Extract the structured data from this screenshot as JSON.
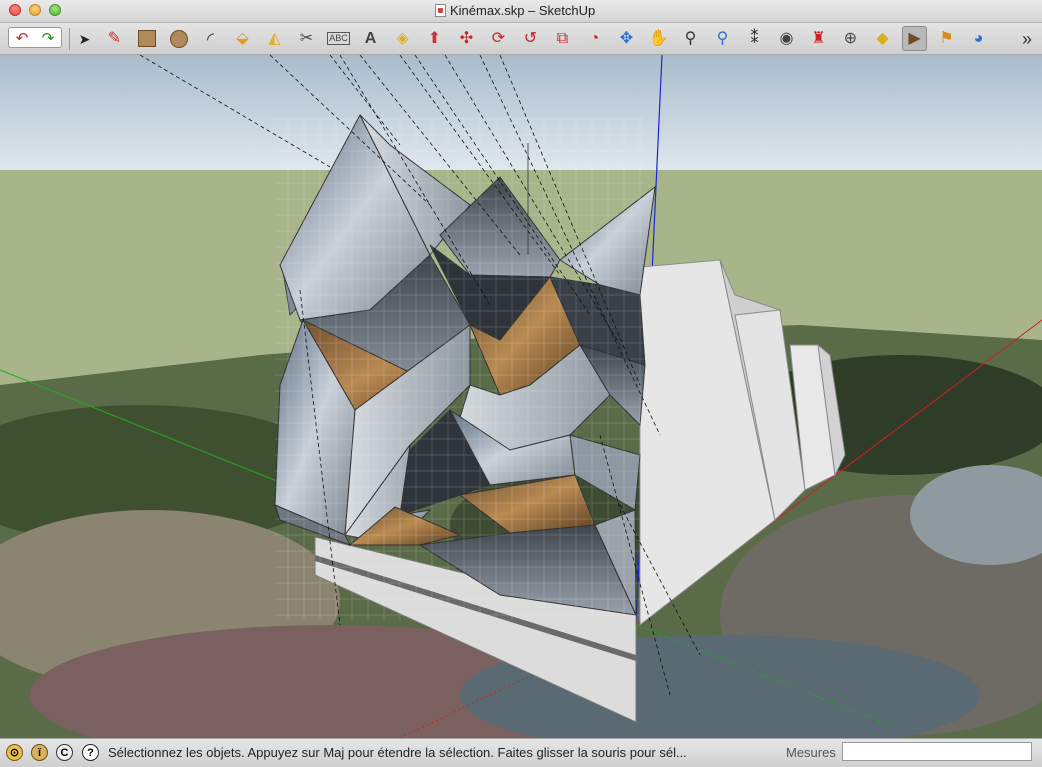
{
  "window": {
    "title": "Kinémax.skp – SketchUp",
    "document_icon": "document-icon"
  },
  "toolbar": {
    "overflow_label": "»",
    "tools": [
      {
        "name": "undo-redo",
        "icon": "undo-redo-icon"
      },
      {
        "name": "select",
        "icon": "arrow-cursor-icon"
      },
      {
        "name": "line",
        "icon": "pencil-icon"
      },
      {
        "name": "rectangle",
        "icon": "rectangle-icon"
      },
      {
        "name": "circle",
        "icon": "circle-icon"
      },
      {
        "name": "arc",
        "icon": "arc-icon"
      },
      {
        "name": "paint-bucket",
        "icon": "paint-bucket-icon"
      },
      {
        "name": "tape-measure",
        "icon": "tape-measure-icon"
      },
      {
        "name": "dimension",
        "icon": "dimension-icon"
      },
      {
        "name": "text",
        "icon": "text-icon"
      },
      {
        "name": "axes",
        "icon": "axes-icon"
      },
      {
        "name": "eraser",
        "icon": "eraser-icon"
      },
      {
        "name": "push-pull",
        "icon": "push-pull-icon"
      },
      {
        "name": "move",
        "icon": "move-icon"
      },
      {
        "name": "rotate",
        "icon": "rotate-icon"
      },
      {
        "name": "follow-me",
        "icon": "follow-me-icon"
      },
      {
        "name": "scale",
        "icon": "scale-icon"
      },
      {
        "name": "offset",
        "icon": "offset-icon"
      },
      {
        "name": "orbit",
        "icon": "orbit-icon"
      },
      {
        "name": "pan",
        "icon": "hand-icon"
      },
      {
        "name": "zoom",
        "icon": "magnifier-icon"
      },
      {
        "name": "zoom-extents",
        "icon": "zoom-extents-icon"
      },
      {
        "name": "walk",
        "icon": "footprints-icon"
      },
      {
        "name": "look-around",
        "icon": "eye-icon"
      },
      {
        "name": "position-camera",
        "icon": "position-camera-icon"
      },
      {
        "name": "section-plane",
        "icon": "section-plane-icon"
      },
      {
        "name": "3d-warehouse",
        "icon": "warehouse-icon"
      },
      {
        "name": "component",
        "icon": "component-icon"
      },
      {
        "name": "photo-textures",
        "icon": "photo-textures-icon"
      },
      {
        "name": "google-earth",
        "icon": "globe-icon"
      }
    ]
  },
  "status": {
    "hint": "Sélectionnez les objets. Appuyez sur Maj pour étendre la sélection. Faites glisser la souris pour sél...",
    "icons": [
      "geo-location-icon",
      "credits-icon",
      "copyright-icon",
      "help-icon"
    ]
  },
  "measurements": {
    "label": "Mesures",
    "value": ""
  },
  "colors": {
    "sky": "#c9d6e0",
    "ground": "#a9b78b",
    "axis_blue": "#2222dd",
    "axis_red": "#cc2222",
    "axis_green": "#22aa22"
  }
}
